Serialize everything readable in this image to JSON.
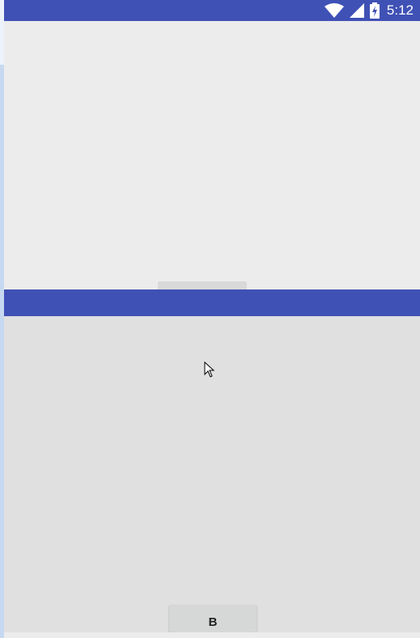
{
  "status_bar": {
    "time": "5:12",
    "icons": [
      "wifi-icon",
      "cell-signal-icon",
      "battery-charging-icon"
    ],
    "color": "#3f51b5"
  },
  "bottom_pane": {
    "button_label": "B"
  },
  "colors": {
    "accent": "#3f51b5",
    "top_pane_bg": "#ececec",
    "bottom_pane_bg": "#e0e0e0"
  }
}
